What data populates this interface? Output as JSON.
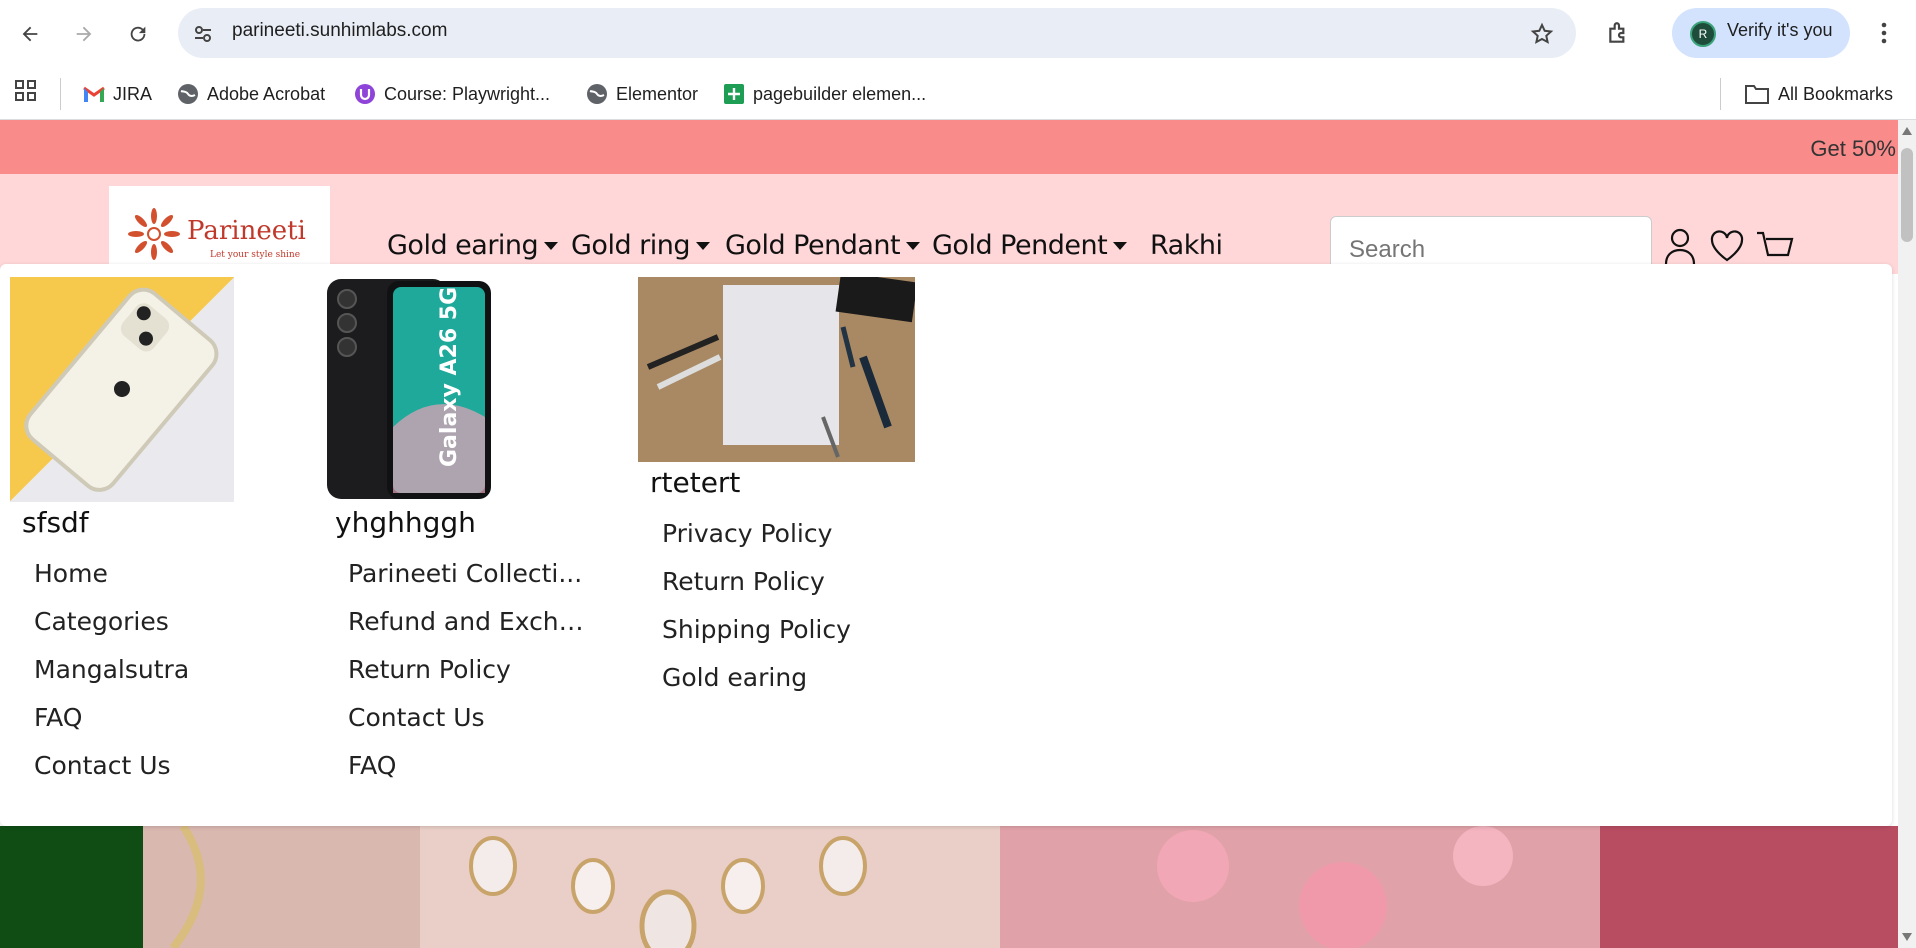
{
  "browser": {
    "url": "parineeti.sunhimlabs.com",
    "profile_button": "Verify it's you",
    "profile_initial": "R",
    "bookmarks": [
      {
        "label": "JIRA",
        "icon": "gmail-icon"
      },
      {
        "label": "Adobe Acrobat",
        "icon": "globe-icon"
      },
      {
        "label": "Course: Playwright...",
        "icon": "course-icon"
      },
      {
        "label": "Elementor",
        "icon": "globe-icon"
      },
      {
        "label": "pagebuilder elemen...",
        "icon": "sheets-icon"
      }
    ],
    "all_bookmarks": "All Bookmarks"
  },
  "site": {
    "promo": "Get 50%",
    "logo": {
      "name": "Parineeti",
      "tagline": "Let your style shine"
    },
    "nav": [
      {
        "label": "Gold earing",
        "dropdown": true
      },
      {
        "label": "Gold ring",
        "dropdown": true
      },
      {
        "label": "Gold Pendant",
        "dropdown": true
      },
      {
        "label": "Gold Pendent",
        "dropdown": true
      },
      {
        "label": "Rakhi",
        "dropdown": false
      }
    ],
    "search_placeholder": "Search",
    "mega_menu": {
      "columns": [
        {
          "title": "sfsdf",
          "image": "white-iphone-photo",
          "links": [
            "Home",
            "Categories",
            "Mangalsutra",
            "FAQ",
            "Contact Us"
          ]
        },
        {
          "title": "yhghhggh",
          "image": "galaxy-a26-phone-photo",
          "image_text": "Galaxy A26 5G",
          "links": [
            "Parineeti Collecti...",
            "Refund and Excha...",
            "Return Policy",
            "Contact Us",
            "FAQ"
          ]
        },
        {
          "title": "rtetert",
          "image": "paper-and-pens-photo",
          "links": [
            "Privacy Policy",
            "Return Policy",
            "Shipping Policy",
            "Gold earing"
          ]
        }
      ]
    }
  },
  "colors": {
    "promo": "#f98b8b",
    "header": "#ffd7d9",
    "accent": "#d3e3fd"
  }
}
